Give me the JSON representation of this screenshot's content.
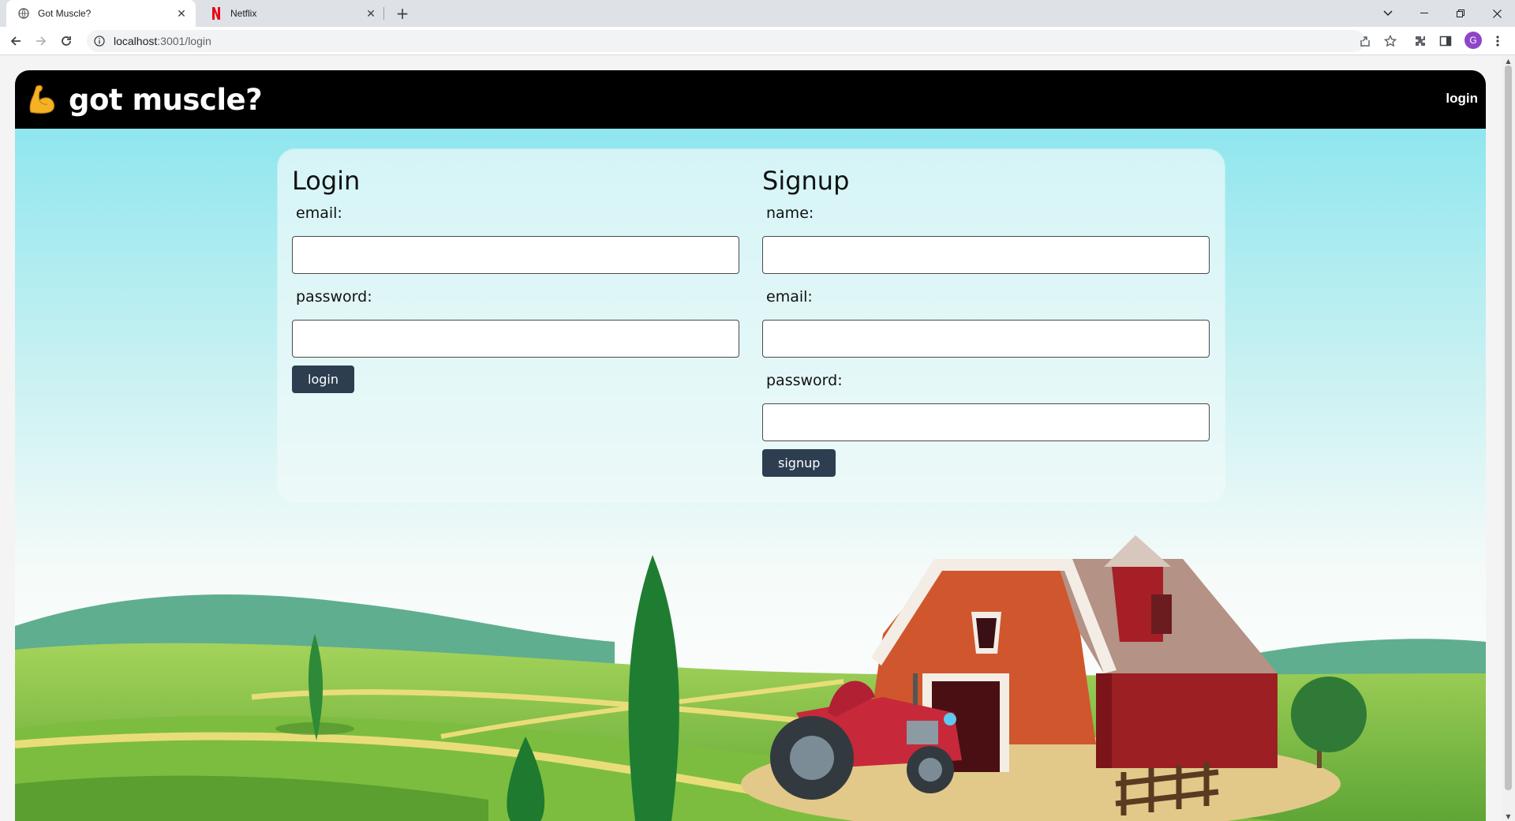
{
  "browser": {
    "tabs": [
      {
        "title": "Got Muscle?",
        "active": true
      },
      {
        "title": "Netflix",
        "active": false
      }
    ],
    "url": {
      "host": "localhost",
      "path": ":3001/login"
    },
    "profile_initial": "G"
  },
  "navbar": {
    "brand": "got muscle?",
    "login_link": "login"
  },
  "login": {
    "title": "Login",
    "email_label": "email:",
    "password_label": "password:",
    "button": "login"
  },
  "signup": {
    "title": "Signup",
    "name_label": "name:",
    "email_label": "email:",
    "password_label": "password:",
    "button": "signup"
  },
  "colors": {
    "navbar_bg": "#000000",
    "button_bg": "#2c3e50",
    "sky_top": "#8fe6ee",
    "grass": "#7fc242",
    "barn_red": "#c0432b"
  }
}
